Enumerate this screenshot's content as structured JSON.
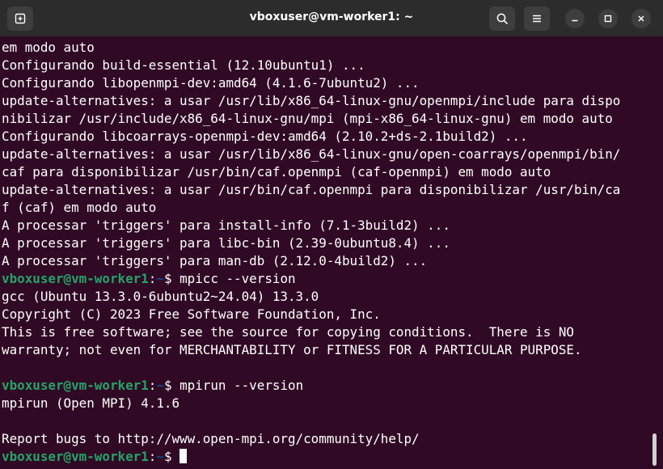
{
  "window": {
    "title": "vboxuser@vm-worker1: ~"
  },
  "icons": {
    "new_tab": "new-tab-icon",
    "search": "search-icon",
    "menu": "hamburger-menu-icon",
    "minimize": "minimize-icon",
    "maximize": "maximize-icon",
    "close": "close-icon"
  },
  "colors": {
    "terminal_bg": "#300a24",
    "titlebar_bg": "#2c2c2c",
    "prompt_user": "#26a269",
    "prompt_path": "#12488b",
    "text": "#ffffff"
  },
  "terminal": {
    "lines": [
      {
        "type": "text",
        "text": "em modo auto"
      },
      {
        "type": "text",
        "text": "Configurando build-essential (12.10ubuntu1) ..."
      },
      {
        "type": "text",
        "text": "Configurando libopenmpi-dev:amd64 (4.1.6-7ubuntu2) ..."
      },
      {
        "type": "text",
        "text": "update-alternatives: a usar /usr/lib/x86_64-linux-gnu/openmpi/include para dispo"
      },
      {
        "type": "text",
        "text": "nibilizar /usr/include/x86_64-linux-gnu/mpi (mpi-x86_64-linux-gnu) em modo auto"
      },
      {
        "type": "text",
        "text": "Configurando libcoarrays-openmpi-dev:amd64 (2.10.2+ds-2.1build2) ..."
      },
      {
        "type": "text",
        "text": "update-alternatives: a usar /usr/lib/x86_64-linux-gnu/open-coarrays/openmpi/bin/"
      },
      {
        "type": "text",
        "text": "caf para disponibilizar /usr/bin/caf.openmpi (caf-openmpi) em modo auto"
      },
      {
        "type": "text",
        "text": "update-alternatives: a usar /usr/bin/caf.openmpi para disponibilizar /usr/bin/ca"
      },
      {
        "type": "text",
        "text": "f (caf) em modo auto"
      },
      {
        "type": "text",
        "text": "A processar 'triggers' para install-info (7.1-3build2) ..."
      },
      {
        "type": "text",
        "text": "A processar 'triggers' para libc-bin (2.39-0ubuntu8.4) ..."
      },
      {
        "type": "text",
        "text": "A processar 'triggers' para man-db (2.12.0-4build2) ..."
      },
      {
        "type": "prompt",
        "user": "vboxuser@vm-worker1",
        "sep": ":",
        "path": "~",
        "sym": "$ ",
        "cmd": "mpicc --version"
      },
      {
        "type": "text",
        "text": "gcc (Ubuntu 13.3.0-6ubuntu2~24.04) 13.3.0"
      },
      {
        "type": "text",
        "text": "Copyright (C) 2023 Free Software Foundation, Inc."
      },
      {
        "type": "text",
        "text": "This is free software; see the source for copying conditions.  There is NO"
      },
      {
        "type": "text",
        "text": "warranty; not even for MERCHANTABILITY or FITNESS FOR A PARTICULAR PURPOSE."
      },
      {
        "type": "text",
        "text": ""
      },
      {
        "type": "prompt",
        "user": "vboxuser@vm-worker1",
        "sep": ":",
        "path": "~",
        "sym": "$ ",
        "cmd": "mpirun --version"
      },
      {
        "type": "text",
        "text": "mpirun (Open MPI) 4.1.6"
      },
      {
        "type": "text",
        "text": ""
      },
      {
        "type": "text",
        "text": "Report bugs to http://www.open-mpi.org/community/help/"
      },
      {
        "type": "prompt",
        "user": "vboxuser@vm-worker1",
        "sep": ":",
        "path": "~",
        "sym": "$ ",
        "cmd": "",
        "cursor": true
      }
    ]
  }
}
